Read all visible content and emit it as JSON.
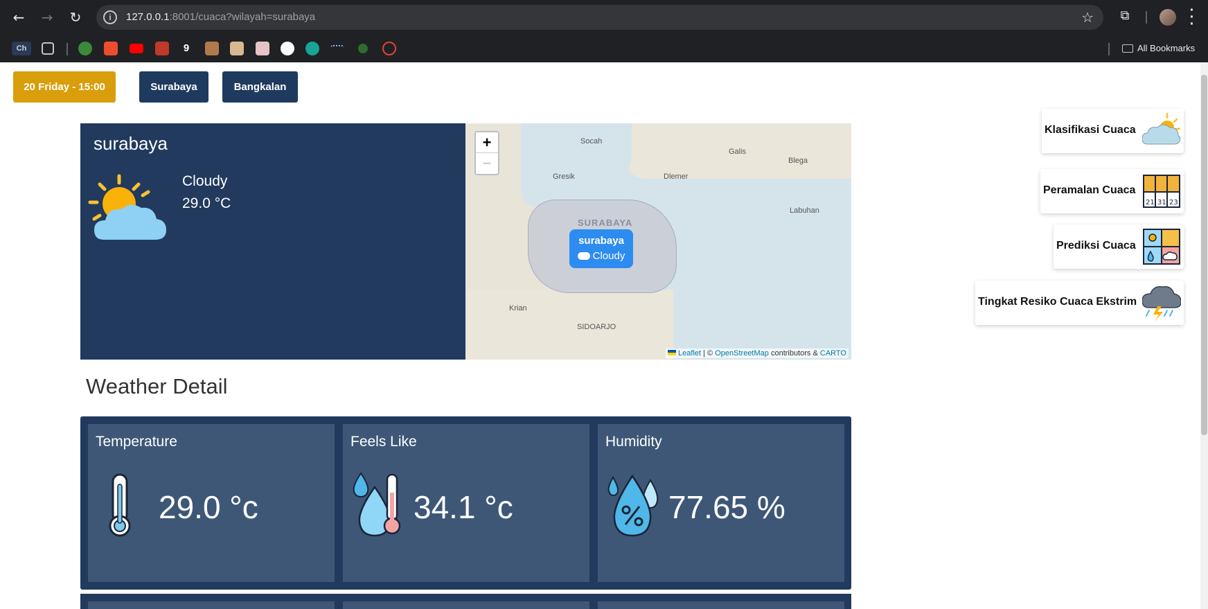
{
  "browser": {
    "url_host": "127.0.0.1",
    "url_rest": ":8001/cuaca?wilayah=surabaya",
    "bookmarks_label": "All Bookmarks",
    "bookmark_first": "Ch"
  },
  "header": {
    "date_label": "20 Friday - 15:00",
    "regions": [
      "Surabaya",
      "Bangkalan"
    ]
  },
  "current": {
    "city": "surabaya",
    "condition": "Cloudy",
    "temperature": "29.0 °C"
  },
  "map": {
    "zoom_in": "+",
    "zoom_out": "−",
    "labels": {
      "socah": "Socah",
      "galis": "Galis",
      "blega": "Blega",
      "gresik": "Gresik",
      "dlemer": "Dlemer",
      "labuhan": "Labuhan",
      "surabaya": "SURABAYA",
      "krian": "Krian",
      "sidoarjo": "SIDOARJO"
    },
    "marker_city": "surabaya",
    "marker_condition": "Cloudy",
    "attribution": {
      "leaflet": "Leaflet",
      "sep": "| ©",
      "osm": "OpenStreetMap",
      "contrib": "contributors &",
      "carto": "CARTO"
    }
  },
  "detail": {
    "title": "Weather Detail",
    "cards": [
      {
        "label": "Temperature",
        "value": "29.0 °c"
      },
      {
        "label": "Feels Like",
        "value": "34.1 °c"
      },
      {
        "label": "Humidity",
        "value": "77.65 %"
      }
    ]
  },
  "side_menu": [
    {
      "label": "Klasifikasi Cuaca"
    },
    {
      "label": "Peramalan Cuaca"
    },
    {
      "label": "Prediksi Cuaca"
    },
    {
      "label": "Tingkat Resiko Cuaca Ekstrim"
    }
  ],
  "colors": {
    "navy": "#213a5e",
    "card": "#3e5777",
    "date_button": "#d99e0b",
    "marker": "#2d8cf0"
  }
}
